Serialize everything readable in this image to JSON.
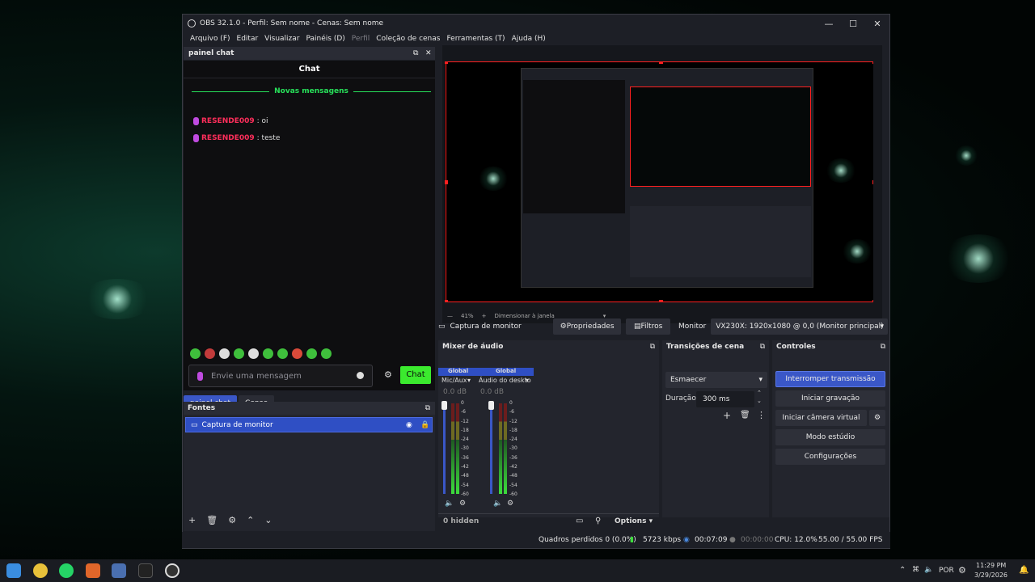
{
  "window": {
    "title": "OBS 32.1.0 - Perfil: Sem nome - Cenas: Sem nome"
  },
  "menu": {
    "items": [
      "Arquivo (F)",
      "Editar",
      "Visualizar",
      "Painéis (D)",
      "Perfil",
      "Coleção de cenas",
      "Ferramentas (T)",
      "Ajuda (H)"
    ]
  },
  "chat_dock": {
    "title": "painel chat",
    "header": "Chat",
    "new_messages": "Novas mensagens",
    "messages": [
      {
        "user": "RESENDE009",
        "text": ": oi"
      },
      {
        "user": "RESENDE009",
        "text": ": teste"
      }
    ],
    "input_placeholder": "Envie uma mensagem",
    "send_label": "Chat"
  },
  "tabs": {
    "chat": "painel chat",
    "scenes": "Cenas"
  },
  "sources": {
    "title": "Fontes",
    "item": "Captura de monitor"
  },
  "preview": {
    "zoom": "41%",
    "scale_mode": "Dimensionar à janela"
  },
  "source_toolbar": {
    "source": "Captura de monitor",
    "properties": "Propriedades",
    "filters": "Filtros",
    "monitor_label": "Monitor",
    "monitor_value": "VX230X: 1920x1080 @ 0,0 (Monitor principal)"
  },
  "mixer": {
    "title": "Mixer de áudio",
    "channels": [
      {
        "global": "Global",
        "name": "Mic/Aux",
        "db": "0.0 dB"
      },
      {
        "global": "Global",
        "name": "Áudio do deskto",
        "db": "0.0 dB"
      }
    ],
    "scale": [
      "0",
      "-6",
      "-12",
      "-18",
      "-24",
      "-30",
      "-36",
      "-42",
      "-48",
      "-54",
      "-60"
    ],
    "hidden": "0 hidden",
    "options": "Options"
  },
  "transitions": {
    "title": "Transições de cena",
    "selected": "Esmaecer",
    "duration_label": "Duração",
    "duration_value": "300 ms"
  },
  "controls": {
    "title": "Controles",
    "stop_stream": "Interromper transmissão",
    "start_record": "Iniciar gravação",
    "virtual_cam": "Iniciar câmera virtual",
    "studio": "Modo estúdio",
    "settings": "Configurações"
  },
  "status": {
    "dropped": "Quadros perdidos 0 (0.0%)",
    "bitrate": "5723 kbps",
    "stream_time": "00:07:09",
    "record_time": "00:00:00",
    "cpu": "CPU: 12.0%",
    "fps": "55.00 / 55.00 FPS"
  },
  "taskbar": {
    "lang": "POR",
    "time": "11:29 PM",
    "date": "3/29/2026"
  }
}
